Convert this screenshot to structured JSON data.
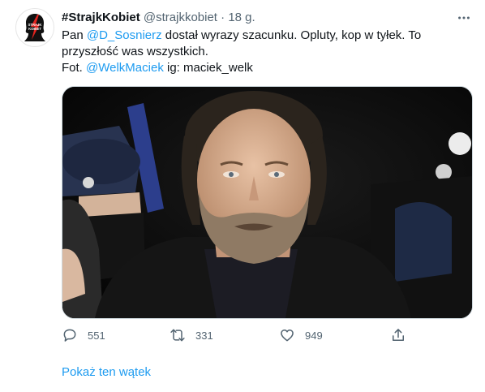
{
  "tweet": {
    "display_name": "#StrajkKobiet",
    "handle": "@strajkkobiet",
    "separator": "·",
    "time": "18 g.",
    "text": {
      "line1_prefix": "Pan ",
      "line1_mention": "@D_Sosnierz",
      "line1_suffix": " dostał wyrazy szacunku. Opluty, kop w tyłek. To",
      "line2": "przyszłość was wszystkich.",
      "line3_prefix": "Fot. ",
      "line3_mention": "@WelkMaciek",
      "line3_suffix": " ig: maciek_welk"
    },
    "avatar_text": [
      "STRAJK",
      "KOBIET"
    ]
  },
  "actions": {
    "reply_count": "551",
    "retweet_count": "331",
    "like_count": "949"
  },
  "show_thread": "Pokaż ten wątek",
  "colors": {
    "accent": "#1d9bf0",
    "muted": "#536471",
    "text": "#0f1419",
    "avatar_red": "#e2241f"
  },
  "icons": [
    "more-icon",
    "reply-icon",
    "retweet-icon",
    "like-icon",
    "share-icon"
  ]
}
